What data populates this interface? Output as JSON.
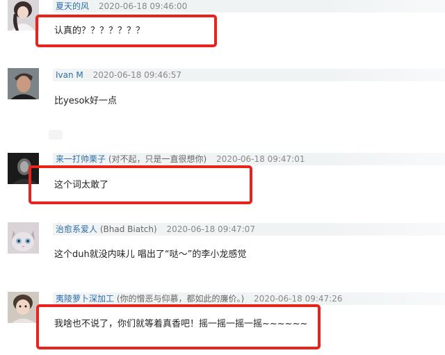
{
  "comments": [
    {
      "username": "夏天的风",
      "alias": "",
      "timestamp": "2020-06-18 09:46:00",
      "text": "认真的？？？？？？？",
      "highlighted": true,
      "avatar": "avatar-girl-photo"
    },
    {
      "username": "Ivan M",
      "alias": "",
      "timestamp": "2020-06-18 09:46:57",
      "text": "比yesok好一点",
      "highlighted": false,
      "avatar": "avatar-man-photo"
    },
    {
      "username": "来一打帅栗子",
      "alias": "(对不起，只是一直很想你)",
      "timestamp": "2020-06-18 09:47:01",
      "text": "这个词太敢了",
      "highlighted": true,
      "avatar": "avatar-dark-photo"
    },
    {
      "username": "治愈系爱人",
      "alias": "(Bhad Biatch)",
      "timestamp": "2020-06-18 09:47:07",
      "text": "这个duh就没内味儿 唱出了“哒～”的李小龙感觉",
      "highlighted": false,
      "avatar": "avatar-cat-photo"
    },
    {
      "username": "夷陵萝卜深加工",
      "alias": "(你的憎恶与仰慕，都如此的廉价。)",
      "timestamp": "2020-06-18 09:47:26",
      "text": "我啥也不说了，你们就等着真香吧！摇一摇一摇一摇~~~~~~",
      "highlighted": true,
      "avatar": "avatar-child-photo"
    }
  ],
  "colors": {
    "username": "#2d6ea8",
    "header_bg": "#f0f3f4",
    "highlight": "#e8221c",
    "body_text": "#222222"
  }
}
